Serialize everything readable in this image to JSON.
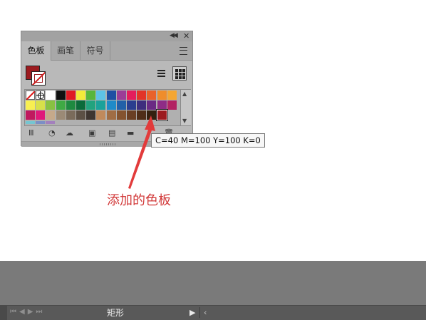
{
  "panel": {
    "tabs": [
      {
        "label": "色板",
        "active": true
      },
      {
        "label": "画笔",
        "active": false
      },
      {
        "label": "符号",
        "active": false
      }
    ],
    "fill_color": "#9c1b1f",
    "stroke_color": "#9c1b1f",
    "view_mode": "grid"
  },
  "swatches": {
    "row1": [
      "none",
      "registration",
      "#ffffff",
      "#111111",
      "#e01b24",
      "#f4eb3a",
      "#57b63c",
      "#5ec3e7",
      "#1f4fa3",
      "#9b3d97",
      "#e41d5c",
      "#e23428",
      "#e9622a",
      "#ef8d2b",
      "#f4a633"
    ],
    "row2": [
      "#f8ef51",
      "#d7e04a",
      "#88c142",
      "#3faa44",
      "#1e8a40",
      "#0b6b3a",
      "#22a37e",
      "#1ba29a",
      "#1f8bc8",
      "#2260a8",
      "#2b3d8f",
      "#3e2d7e",
      "#6a2a84",
      "#8e2c86",
      "#b22263"
    ],
    "row3": [
      "#c0195e",
      "#e0197a",
      "#c6a98a",
      "#9b8a76",
      "#7a6b5b",
      "#5c5045",
      "#3e3530",
      "#c08a5c",
      "#a06d44",
      "#84532f",
      "#6a3f24",
      "#4f2d18",
      "#35200f",
      "#9c1b1f"
    ],
    "row4": [
      "#74c6d2",
      "#7b8fc6",
      "#a37fbd"
    ],
    "selected": "#9c1b1f"
  },
  "tooltip": {
    "text": "C=40 M=100 Y=100 K=0"
  },
  "annotation": {
    "text": "添加的色板",
    "color": "#d23a3a"
  },
  "statusbar": {
    "label": "矩形"
  }
}
